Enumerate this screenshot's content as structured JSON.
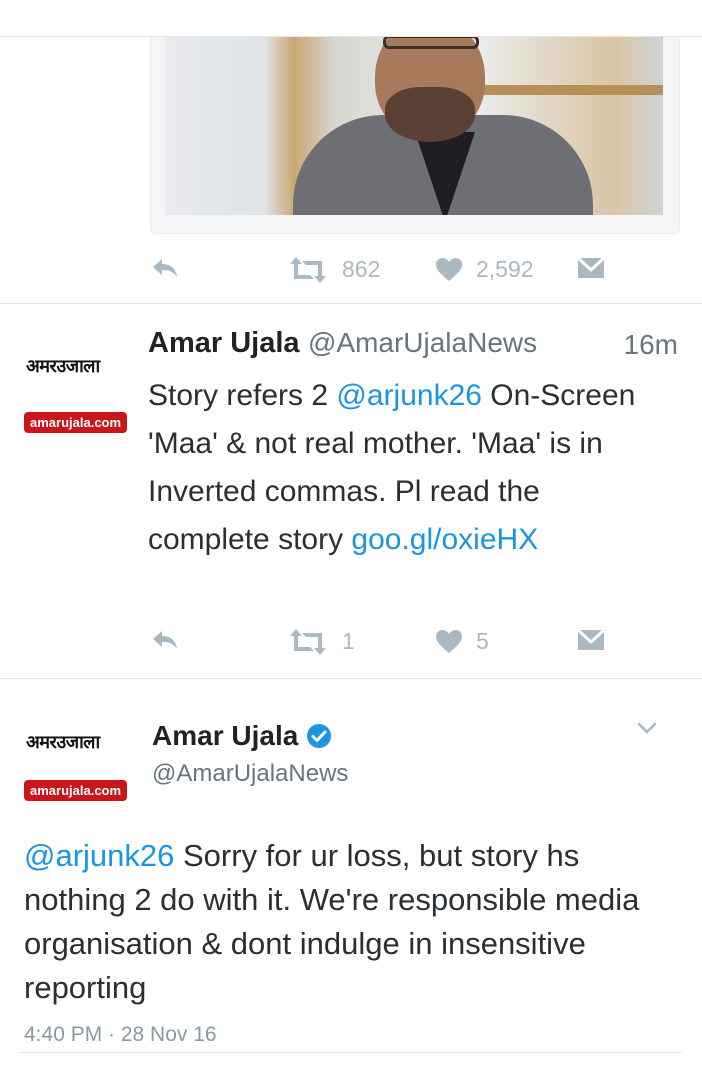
{
  "tweet_top": {
    "retweets": "862",
    "likes": "2,592"
  },
  "tweet_reply": {
    "name": "Amar Ujala",
    "handle": "@AmarUjalaNews",
    "time": "16m",
    "avatar_hindi": "अमरउजाला",
    "avatar_site": "amarujala.com",
    "text_1": "Story refers 2 ",
    "mention": "@arjunk26",
    "text_2": " On-Screen 'Maa' & not real mother. 'Maa' is in Inverted commas. Pl read the complete story ",
    "link": "goo.gl/oxieHX",
    "retweets": "1",
    "likes": "5"
  },
  "tweet_main": {
    "name": "Amar Ujala",
    "handle": "@AmarUjalaNews",
    "avatar_hindi": "अमरउजाला",
    "avatar_site": "amarujala.com",
    "mention": "@arjunk26",
    "text": " Sorry for ur loss, but story hs nothing 2 do with it. We're responsible media organisation & dont indulge in insensitive reporting",
    "timestamp": "4:40 PM · 28 Nov 16"
  },
  "icons": {
    "reply": "reply-icon",
    "retweet": "retweet-icon",
    "like": "heart-icon",
    "dm": "envelope-icon",
    "verified": "verified-badge-icon",
    "caret": "chevron-down-icon"
  },
  "colors": {
    "link": "#1b95e0",
    "icon": "#aab8c2",
    "logo_red": "#c9161d"
  }
}
